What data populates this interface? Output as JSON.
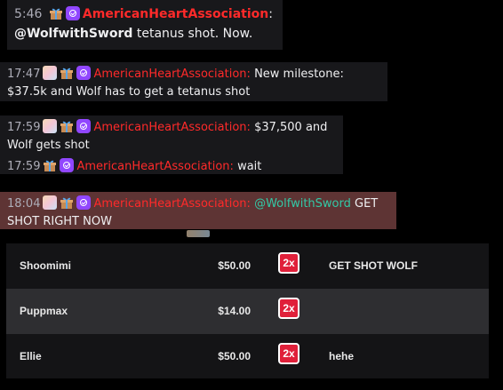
{
  "chat": {
    "pinned": {
      "time": "5:46",
      "user": "AmericanHeartAssociation",
      "separator": ":",
      "mention": "@WolfwithSword",
      "text": " tetanus shot. Now."
    },
    "messages": [
      {
        "time": "17:47",
        "user": "AmericanHeartAssociation:",
        "text": "New milestone: $37.5k and Wolf has to get a tetanus shot"
      },
      {
        "time": "17:59",
        "user": "AmericanHeartAssociation:",
        "text": "$37,500 and Wolf gets shot"
      },
      {
        "time": "17:59",
        "user": "AmericanHeartAssociation:",
        "text": "wait"
      },
      {
        "time": "18:04",
        "user": "AmericanHeartAssociation:",
        "mention": "@WolfwithSword",
        "text": " GET SHOT RIGHT NOW"
      }
    ]
  },
  "donations": {
    "rows": [
      {
        "name": "Shoomimi",
        "amount": "$50.00",
        "multiplier": "2x",
        "message": "GET SHOT WOLF"
      },
      {
        "name": "Puppmax",
        "amount": "$14.00",
        "multiplier": "2x",
        "message": ""
      },
      {
        "name": "Ellie",
        "amount": "$50.00",
        "multiplier": "2x",
        "message": "hehe"
      }
    ],
    "multiplier_color": "#e0203a"
  },
  "colors": {
    "username": "#ff2a2a",
    "mention": "#33c9a6",
    "highlight": "#5e3434",
    "verified_badge": "#9147ff"
  }
}
